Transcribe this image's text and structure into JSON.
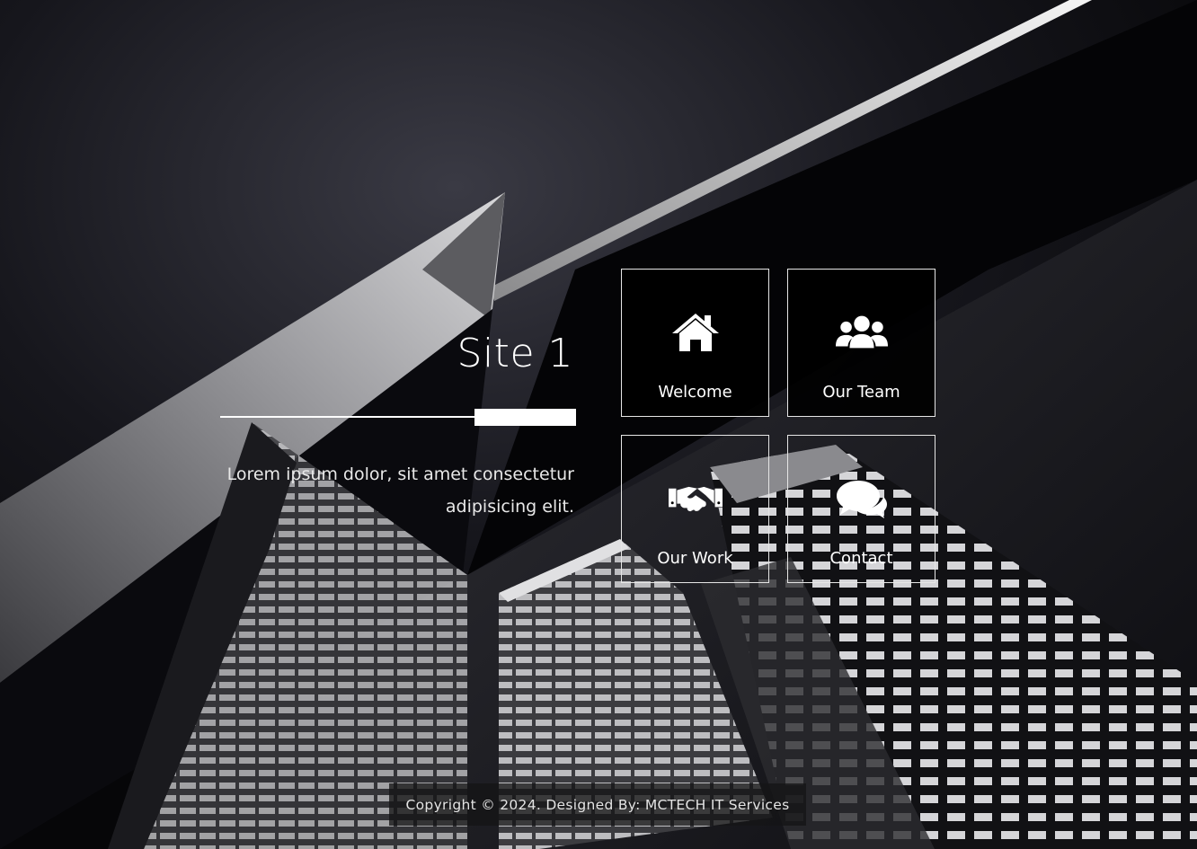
{
  "hero": {
    "title": "Site 1",
    "description": "Lorem ipsum dolor, sit amet consectetur adipisicing elit."
  },
  "tiles": [
    {
      "label": "Welcome",
      "icon": "home-icon"
    },
    {
      "label": "Our Team",
      "icon": "users-icon"
    },
    {
      "label": "Our Work",
      "icon": "handshake-icon"
    },
    {
      "label": "Contact",
      "icon": "comments-icon"
    }
  ],
  "footer": {
    "copyright": "Copyright © 2024. Designed By: MCTECH IT Services"
  },
  "colors": {
    "background": "#000000",
    "tile_border": "#e6e6e6",
    "text": "#ffffff"
  }
}
